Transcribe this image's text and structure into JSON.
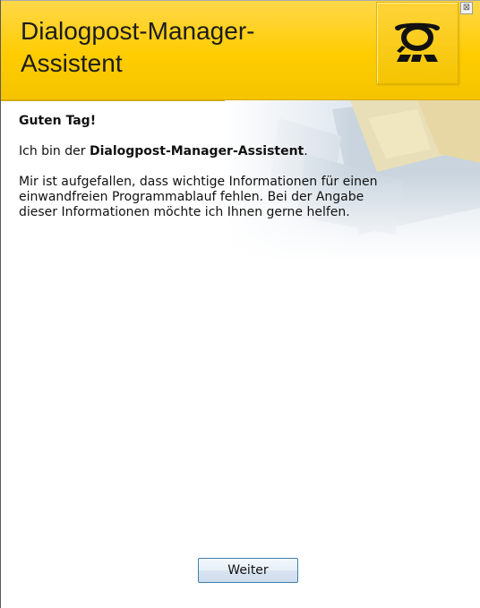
{
  "header": {
    "title": "Dialogpost-Manager-\nAssistent",
    "logo": "deutsche-post-horn-logo",
    "close_label": "⊠"
  },
  "content": {
    "greeting": "Guten Tag!",
    "intro_prefix": "Ich bin der ",
    "intro_name": "Dialogpost-Manager-Assistent",
    "intro_suffix": ".",
    "body": "Mir ist aufgefallen, dass wichtige Informationen für einen\neinwandfreien Programmablauf fehlen. Bei der Angabe\ndieser Informationen möchte ich Ihnen gerne helfen."
  },
  "footer": {
    "next_label": "Weiter"
  },
  "colors": {
    "brand_yellow": "#ffcc00",
    "button_border": "#3c7fb1"
  }
}
